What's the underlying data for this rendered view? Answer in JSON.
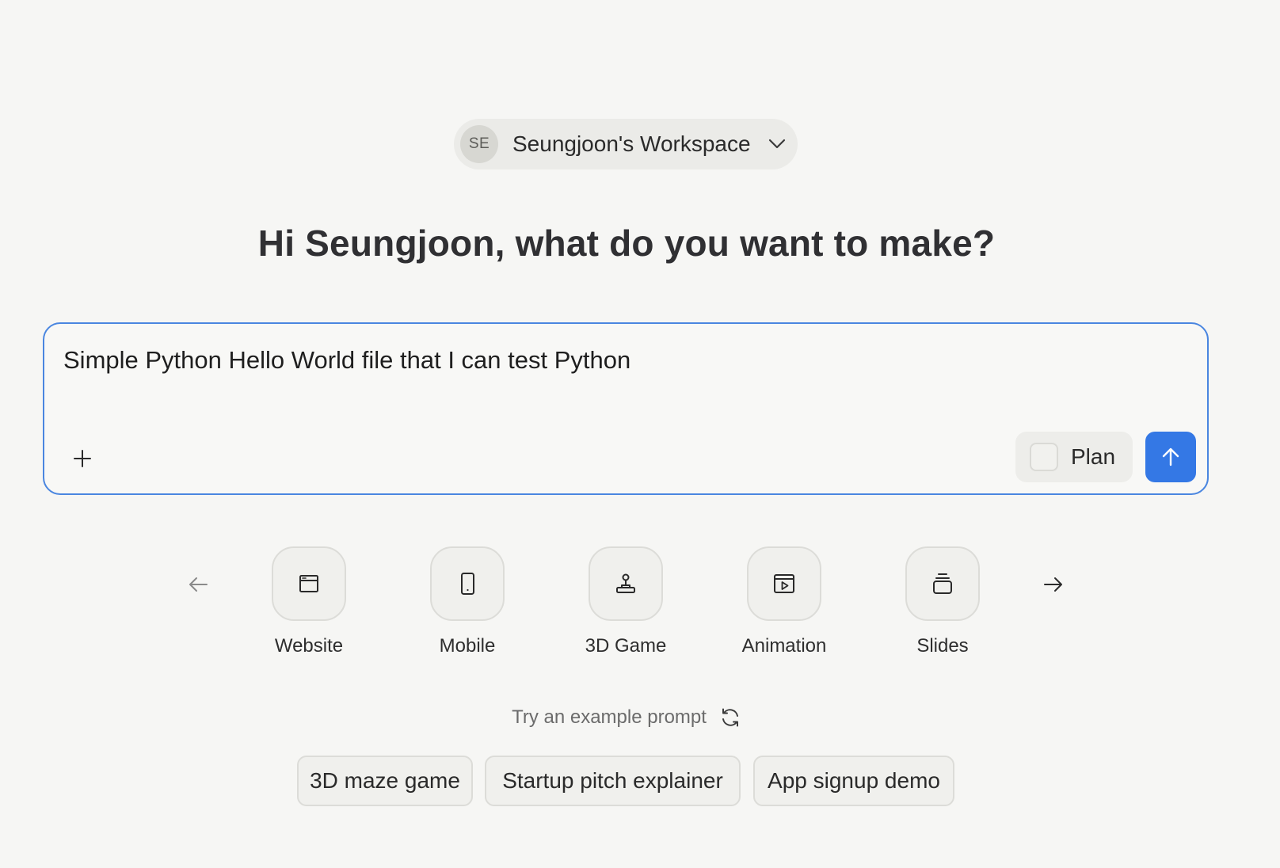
{
  "workspace": {
    "avatar_initials": "SE",
    "name": "Seungjoon's Workspace",
    "chevron_icon": "chevron-down-icon"
  },
  "heading": "Hi Seungjoon, what do you want to make?",
  "prompt": {
    "value": "Simple Python Hello World file that I can test Python",
    "add_icon": "plus-icon",
    "plan_label": "Plan",
    "plan_checked": false,
    "send_icon": "arrow-up-icon",
    "accent_color": "#3478e5"
  },
  "categories": [
    {
      "label": "Website",
      "icon": "browser-window-icon"
    },
    {
      "label": "Mobile",
      "icon": "phone-icon"
    },
    {
      "label": "3D Game",
      "icon": "joystick-icon"
    },
    {
      "label": "Animation",
      "icon": "play-frame-icon"
    },
    {
      "label": "Slides",
      "icon": "slides-stack-icon"
    }
  ],
  "examples": {
    "label": "Try an example prompt",
    "refresh_icon": "refresh-icon",
    "chips": [
      "3D maze game",
      "Startup pitch explainer",
      "App signup demo"
    ]
  }
}
